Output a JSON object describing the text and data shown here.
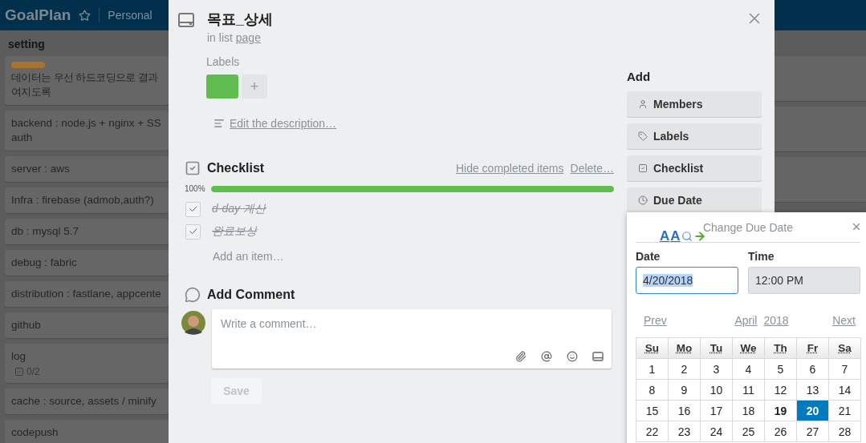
{
  "board_header": {
    "logo": "GoalPlan",
    "team": "Personal"
  },
  "list": {
    "title": "setting",
    "cards": [
      {
        "text": "데이터는 우선 하드코딩으로 결과\n여지도록",
        "labels": [
          {
            "color": "#a8722f"
          }
        ]
      },
      {
        "text": "backend : node.js + nginx + SS\nauth"
      },
      {
        "text": "server : aws"
      },
      {
        "text": "Infra : firebase (admob,auth?)"
      },
      {
        "text": "db : mysql 5.7"
      },
      {
        "text": "debug : fabric"
      },
      {
        "text": "distribution : fastlane, appcente"
      },
      {
        "text": "github"
      },
      {
        "text": "log",
        "checklist_badge": "0/2"
      },
      {
        "text": "cache : source, assets / minify"
      },
      {
        "text": "codepush"
      }
    ]
  },
  "card_modal": {
    "title": "목표_상세",
    "list_prefix": "in list",
    "list_name": "page",
    "labels_heading": "Labels",
    "labels": [
      {
        "color": "#61bd4f"
      }
    ],
    "add_label": "+",
    "description_link": "Edit the description…",
    "checklist": {
      "title": "Checklist",
      "actions": [
        "Hide completed items",
        "Delete…"
      ],
      "percent": "100%",
      "level": 1,
      "items": [
        {
          "text": "d-day 계산",
          "checked": true
        },
        {
          "text": "완료보상",
          "checked": true
        }
      ],
      "add_item": "Add an item…"
    },
    "comment": {
      "title": "Add Comment",
      "placeholder": "Write a comment…",
      "save": "Save",
      "save_disabled": true
    },
    "sidebar": {
      "title": "Add",
      "buttons": [
        {
          "kind": "members",
          "label": "Members"
        },
        {
          "kind": "labels",
          "label": "Labels"
        },
        {
          "kind": "checklist",
          "label": "Checklist"
        },
        {
          "kind": "due_date",
          "label": "Due Date"
        }
      ]
    }
  },
  "due_date_popover": {
    "title": "Change Due Date",
    "extension_letters": [
      "A",
      "A"
    ],
    "date_label": "Date",
    "date_value": "4/20/2018",
    "time_label": "Time",
    "time_value": "12:00 PM",
    "prev": "Prev",
    "month": "April",
    "year": "2018",
    "next": "Next",
    "weekdays": [
      "Su",
      "Mo",
      "Tu",
      "We",
      "Th",
      "Fr",
      "Sa"
    ],
    "weeks": [
      [
        {
          "day": "1",
          "selected": false,
          "today": false
        },
        {
          "day": "2",
          "selected": false,
          "today": false
        },
        {
          "day": "3",
          "selected": false,
          "today": false
        },
        {
          "day": "4",
          "selected": false,
          "today": false
        },
        {
          "day": "5",
          "selected": false,
          "today": false
        },
        {
          "day": "6",
          "selected": false,
          "today": false
        },
        {
          "day": "7",
          "selected": false,
          "today": false
        }
      ],
      [
        {
          "day": "8",
          "selected": false,
          "today": false
        },
        {
          "day": "9",
          "selected": false,
          "today": false
        },
        {
          "day": "10",
          "selected": false,
          "today": false
        },
        {
          "day": "11",
          "selected": false,
          "today": false
        },
        {
          "day": "12",
          "selected": false,
          "today": false
        },
        {
          "day": "13",
          "selected": false,
          "today": false
        },
        {
          "day": "14",
          "selected": false,
          "today": false
        }
      ],
      [
        {
          "day": "15",
          "selected": false,
          "today": false
        },
        {
          "day": "16",
          "selected": false,
          "today": false
        },
        {
          "day": "17",
          "selected": false,
          "today": false
        },
        {
          "day": "18",
          "selected": false,
          "today": false
        },
        {
          "day": "19",
          "selected": false,
          "today": true
        },
        {
          "day": "20",
          "selected": true,
          "today": false
        },
        {
          "day": "21",
          "selected": false,
          "today": false
        }
      ],
      [
        {
          "day": "22",
          "selected": false,
          "today": false
        },
        {
          "day": "23",
          "selected": false,
          "today": false
        },
        {
          "day": "24",
          "selected": false,
          "today": false
        },
        {
          "day": "25",
          "selected": false,
          "today": false
        },
        {
          "day": "26",
          "selected": false,
          "today": false
        },
        {
          "day": "27",
          "selected": false,
          "today": false
        },
        {
          "day": "28",
          "selected": false,
          "today": false
        }
      ]
    ]
  }
}
